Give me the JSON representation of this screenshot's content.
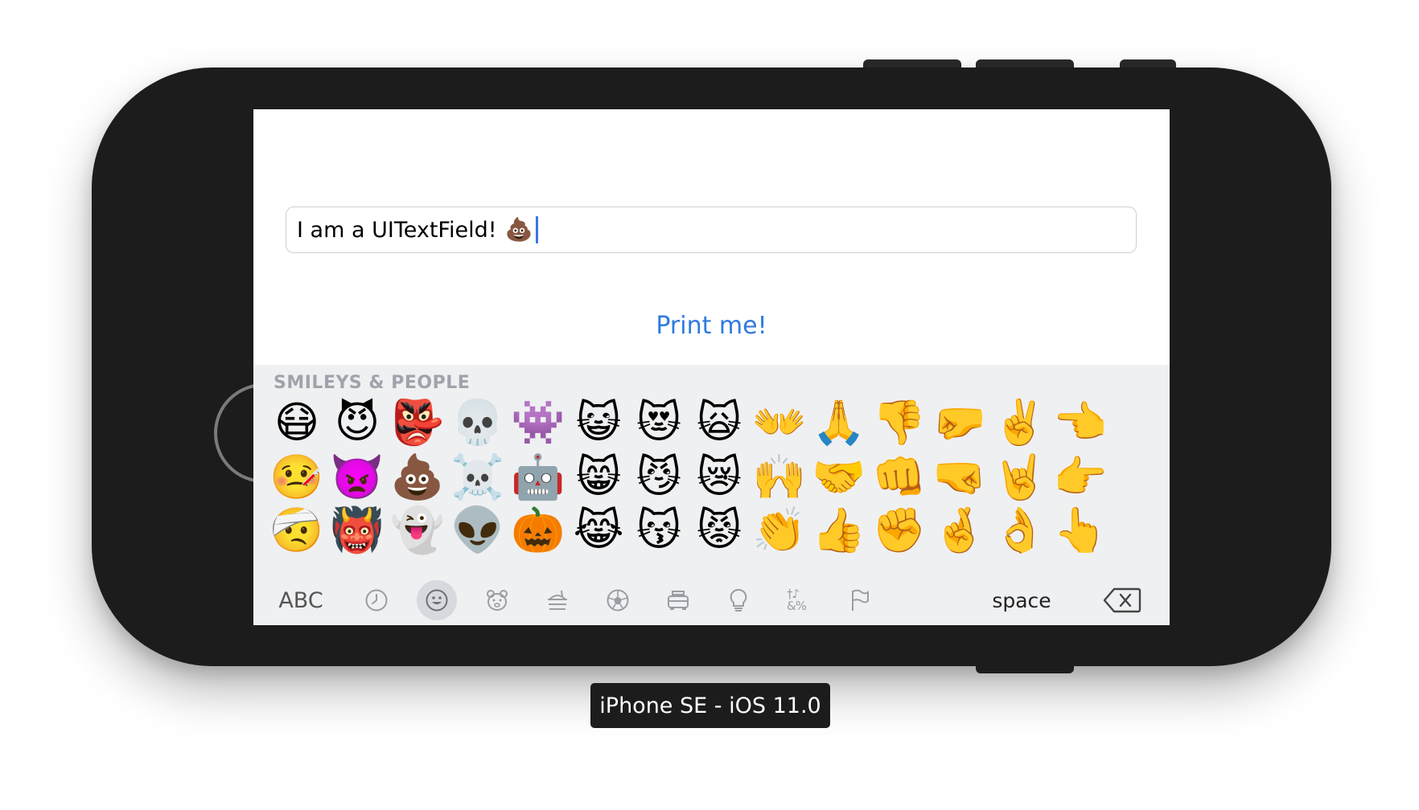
{
  "text_field": {
    "value": "I am a UITextField!",
    "emoji": "💩"
  },
  "print_button": {
    "label": "Print me!"
  },
  "keyboard": {
    "section_title": "SMILEYS & PEOPLE",
    "emoji_rows": [
      [
        "😷",
        "😈",
        "👺",
        "💀",
        "👾",
        "😺",
        "😻",
        "🙀",
        "👐",
        "🙏",
        "👎",
        "🤛",
        "✌️",
        "👈"
      ],
      [
        "🤒",
        "👿",
        "💩",
        "☠️",
        "🤖",
        "😸",
        "😼",
        "😿",
        "🙌",
        "🤝",
        "👊",
        "🤜",
        "🤘",
        "👉"
      ],
      [
        "🤕",
        "👹",
        "👻",
        "👽",
        "🎃",
        "😹",
        "😽",
        "😾",
        "👏",
        "👍",
        "✊",
        "🤞",
        "👌",
        "👆"
      ]
    ],
    "abc_label": "ABC",
    "space_label": "space",
    "categories": [
      "recent-icon",
      "smileys-icon",
      "animals-icon",
      "food-icon",
      "activity-icon",
      "travel-icon",
      "objects-icon",
      "symbols-icon",
      "flags-icon"
    ],
    "active_category": "smileys-icon",
    "symbols_glyph": "†♪&%"
  },
  "device_label": "iPhone SE - iOS 11.0"
}
